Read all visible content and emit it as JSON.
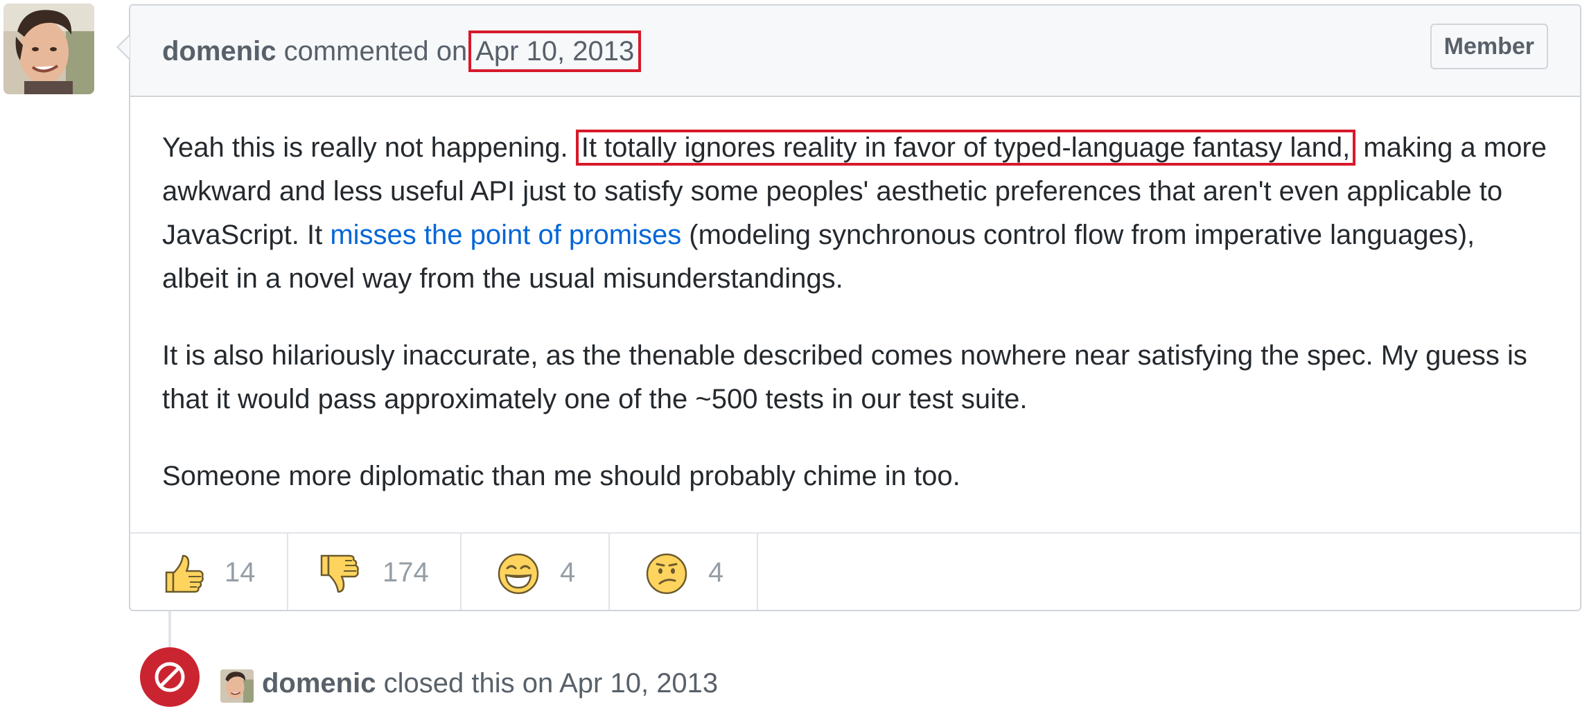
{
  "comment": {
    "author": "domenic",
    "action_text": "commented on",
    "date": "Apr 10, 2013",
    "badge": "Member",
    "body": {
      "p1_part1": "Yeah this is really not happening. ",
      "p1_highlight": "It totally ignores reality in favor of typed-language fantasy land,",
      "p1_part2": " making a more awkward and less useful API just to satisfy some peoples' aesthetic preferences that aren't even applicable to JavaScript. It ",
      "p1_link": "misses the point of promises",
      "p1_part3": " (modeling synchronous control flow from imperative languages), albeit in a novel way from the usual misunderstandings.",
      "p2": "It is also hilariously inaccurate, as the thenable described comes nowhere near satisfying the spec. My guess is that it would pass approximately one of the ~500 tests in our test suite.",
      "p3": "Someone more diplomatic than me should probably chime in too."
    },
    "reactions": [
      {
        "icon": "thumbs-up-icon",
        "count": "14"
      },
      {
        "icon": "thumbs-down-icon",
        "count": "174"
      },
      {
        "icon": "laugh-icon",
        "count": "4"
      },
      {
        "icon": "confused-icon",
        "count": "4"
      }
    ]
  },
  "event": {
    "icon": "circle-slash-icon",
    "author": "domenic",
    "action_text": "closed this on",
    "date": "Apr 10, 2013"
  },
  "colors": {
    "highlight_border": "#d7192a",
    "link": "#0366d6",
    "closed_badge": "#cb2431",
    "emoji_yellow": "#ffd45e"
  }
}
